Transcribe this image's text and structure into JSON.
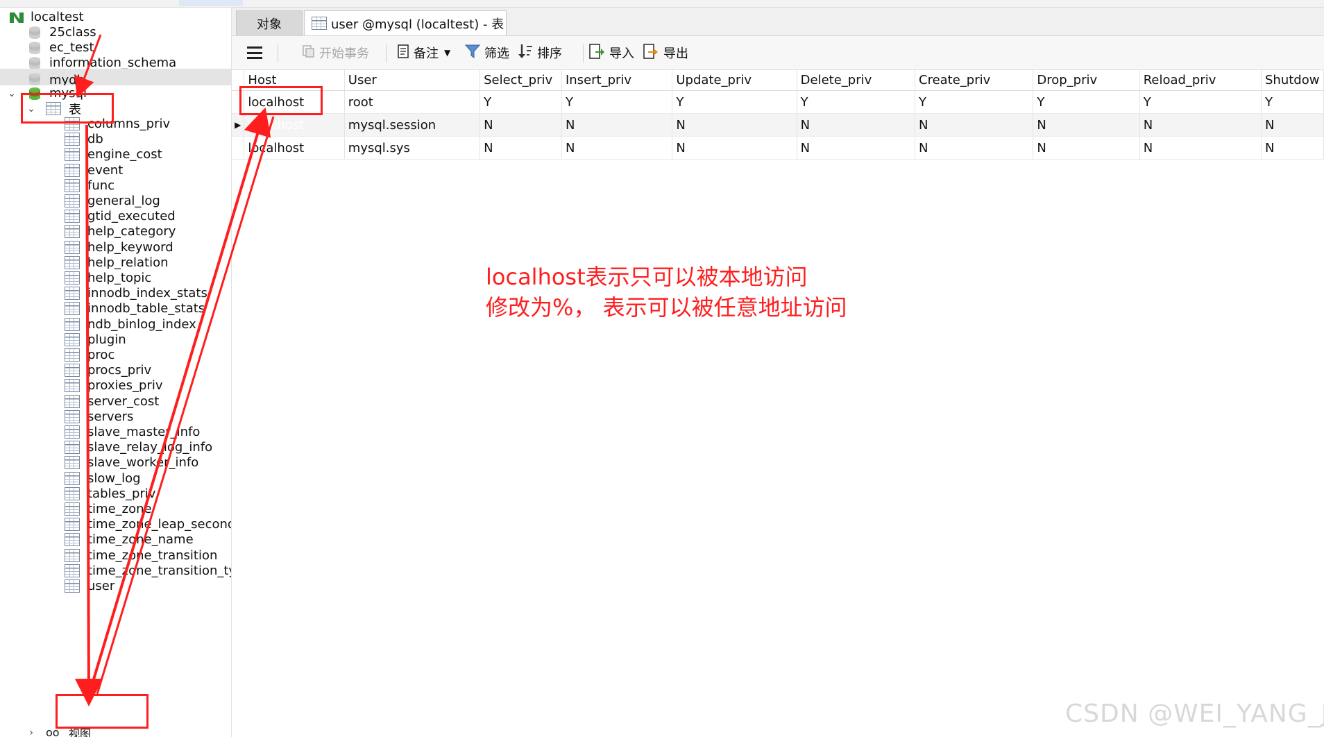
{
  "sidebar": {
    "connection": "localtest",
    "databases": [
      "25class",
      "ec_test",
      "information_schema",
      "mydb",
      "mysql"
    ],
    "tables_folder": "表",
    "tables": [
      "columns_priv",
      "db",
      "engine_cost",
      "event",
      "func",
      "general_log",
      "gtid_executed",
      "help_category",
      "help_keyword",
      "help_relation",
      "help_topic",
      "innodb_index_stats",
      "innodb_table_stats",
      "ndb_binlog_index",
      "plugin",
      "proc",
      "procs_priv",
      "proxies_priv",
      "server_cost",
      "servers",
      "slave_master_info",
      "slave_relay_log_info",
      "slave_worker_info",
      "slow_log",
      "tables_priv",
      "time_zone",
      "time_zone_leap_second",
      "time_zone_name",
      "time_zone_transition",
      "time_zone_transition_type",
      "user"
    ],
    "views_folder": "视图"
  },
  "tabs": {
    "objects": "对象",
    "current": "user @mysql (localtest) - 表"
  },
  "toolbar": {
    "begin_transaction": "开始事务",
    "memo": "备注",
    "filter": "筛选",
    "sort": "排序",
    "import": "导入",
    "export": "导出"
  },
  "grid": {
    "columns": [
      "Host",
      "User",
      "Select_priv",
      "Insert_priv",
      "Update_priv",
      "Delete_priv",
      "Create_priv",
      "Drop_priv",
      "Reload_priv",
      "Shutdow"
    ],
    "rows": [
      [
        "localhost",
        "root",
        "Y",
        "Y",
        "Y",
        "Y",
        "Y",
        "Y",
        "Y",
        "Y"
      ],
      [
        "localhost",
        "mysql.session",
        "N",
        "N",
        "N",
        "N",
        "N",
        "N",
        "N",
        "N"
      ],
      [
        "localhost",
        "mysql.sys",
        "N",
        "N",
        "N",
        "N",
        "N",
        "N",
        "N",
        "N"
      ]
    ]
  },
  "annotation": {
    "line1": "localhost表示只可以被本地访问",
    "line2": "修改为%， 表示可以被任意地址访问",
    "color": "#ff1e1e"
  },
  "watermark": "CSDN @WEI_YANG_JU",
  "colors": {
    "selection": "#0a6fd1",
    "db_active": "#3f9a25"
  }
}
